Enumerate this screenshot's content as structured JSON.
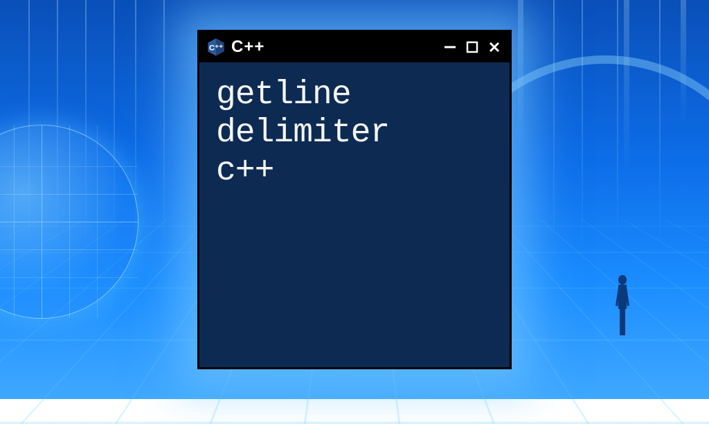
{
  "window": {
    "title": "C++",
    "icon_name": "cpp-logo"
  },
  "content": {
    "line1": "getline",
    "line2": "delimiter",
    "line3": "c++"
  },
  "controls": {
    "minimize": "—",
    "maximize": "☐",
    "close": "✕"
  }
}
